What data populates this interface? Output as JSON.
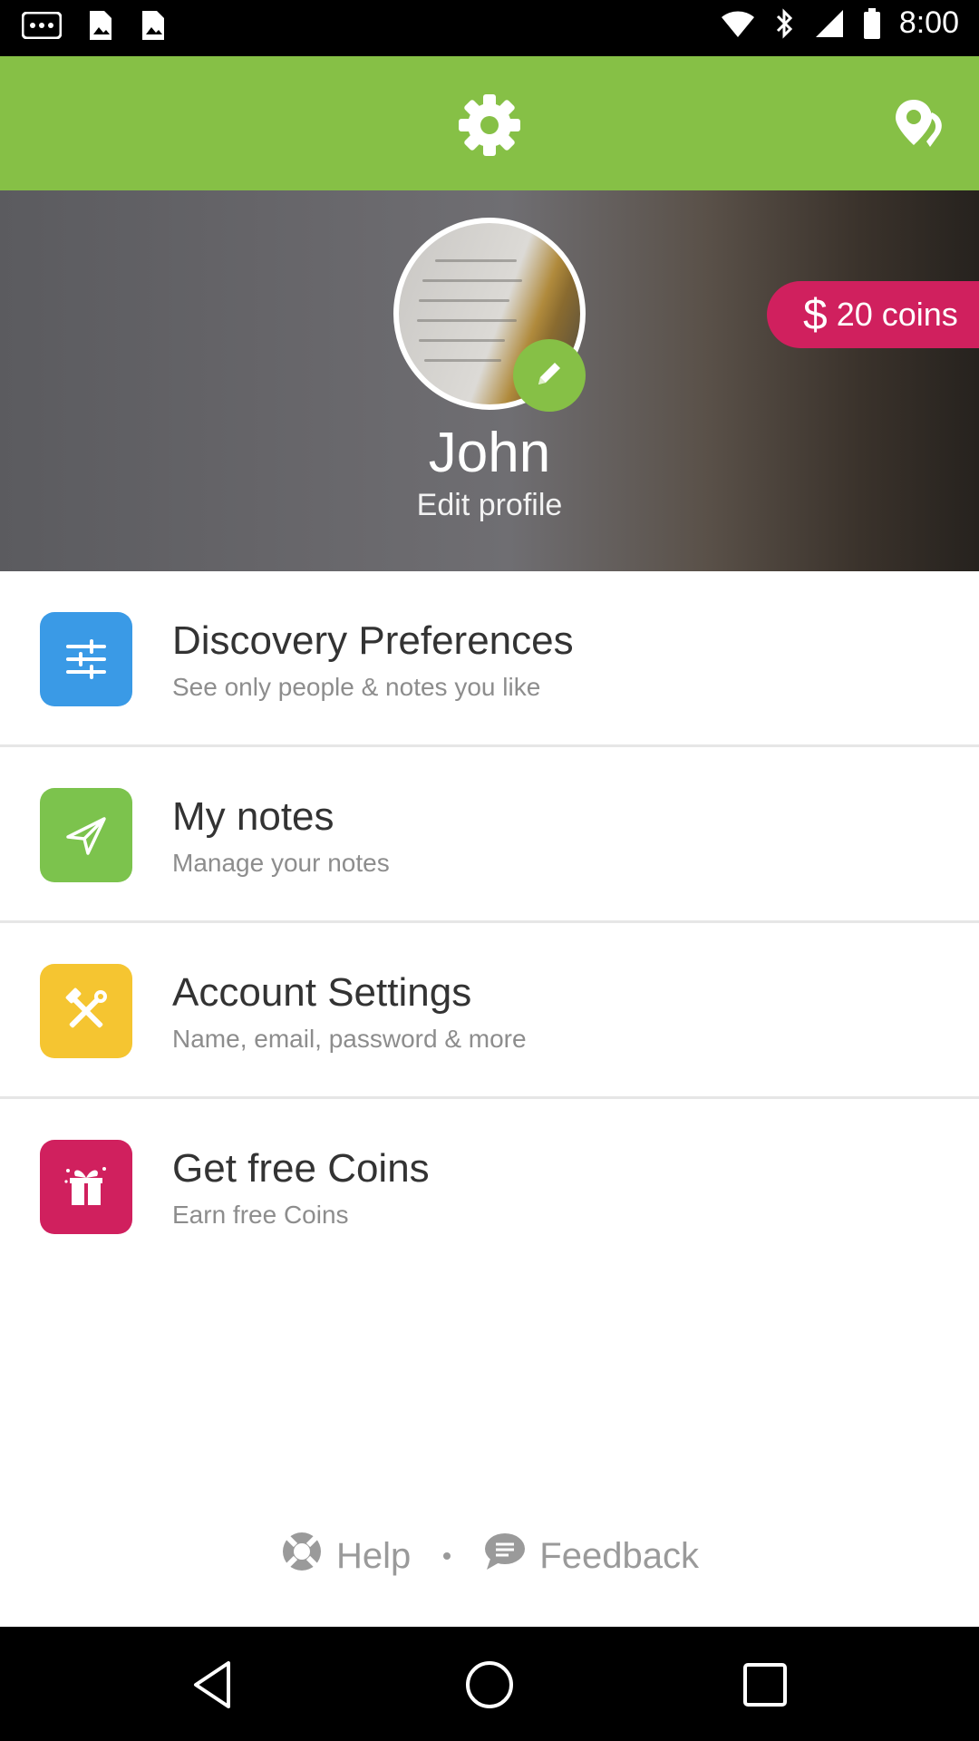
{
  "status_bar": {
    "time": "8:00",
    "icons": [
      "more-icon",
      "image-icon",
      "image-icon",
      "wifi-icon",
      "bluetooth-icon",
      "signal-icon",
      "battery-icon"
    ]
  },
  "top_bar": {
    "icons": [
      "gear-icon",
      "location-icon"
    ],
    "accent_color": "#86c046"
  },
  "profile": {
    "name": "John",
    "edit_label": "Edit profile",
    "coins_label": "20 coins",
    "coins_symbol": "$",
    "coins_color": "#d0205e"
  },
  "menu": {
    "items": [
      {
        "title": "Discovery Preferences",
        "subtitle": "See only people & notes you like",
        "icon": "sliders-icon",
        "color": "#3a9ae6"
      },
      {
        "title": "My notes",
        "subtitle": "Manage your notes",
        "icon": "paper-plane-icon",
        "color": "#7cc34d"
      },
      {
        "title": "Account Settings",
        "subtitle": "Name, email, password & more",
        "icon": "tools-icon",
        "color": "#f5c531"
      },
      {
        "title": "Get free Coins",
        "subtitle": "Earn free Coins",
        "icon": "gift-icon",
        "color": "#d0205e"
      }
    ]
  },
  "footer": {
    "help_label": "Help",
    "feedback_label": "Feedback"
  }
}
